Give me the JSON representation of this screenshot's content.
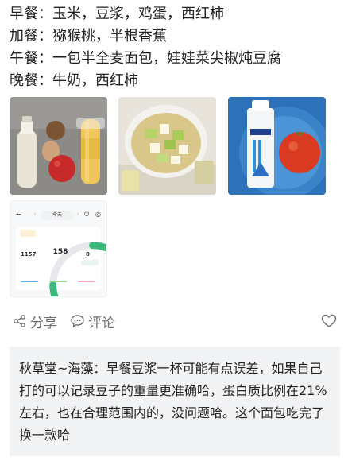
{
  "meals": [
    {
      "label": "早餐",
      "content": "玉米，豆浆，鸡蛋，西红柿"
    },
    {
      "label": "加餐",
      "content": "猕猴桃，半根香蕉"
    },
    {
      "label": "午餐",
      "content": "一包半全麦面包，娃娃菜尖椒炖豆腐"
    },
    {
      "label": "晚餐",
      "content": "牛奶，西红柿"
    }
  ],
  "photos": [
    {
      "name": "breakfast-photo"
    },
    {
      "name": "lunch-photo"
    },
    {
      "name": "dinner-photo"
    },
    {
      "name": "app-screenshot"
    }
  ],
  "app_screenshot": {
    "date_label": "今天",
    "left_value": "1157",
    "center_value": "158",
    "right_value": "0"
  },
  "actions": {
    "share": "分享",
    "comment": "评论"
  },
  "comment": {
    "author": "秋草堂~海藻",
    "text": "早餐豆浆一杯可能有点误差，如果自己打的可以记录豆子的重量更准确哈，蛋白质比例在21%左右，也在合理范围内的，没问题哈。这个面包吃完了换一款哈"
  },
  "colors": {
    "ring_green": "#3cb97a",
    "ring_gray": "#e6e8eb",
    "action_gray": "#6d6f73",
    "comment_bg": "#f2f3f5",
    "tag_bg": "#fdf0d6"
  }
}
